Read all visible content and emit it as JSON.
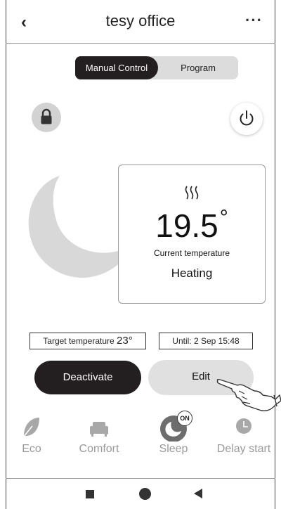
{
  "header": {
    "back_icon": "chevron-left-icon",
    "title": "tesy office",
    "more_icon": "more-horizontal-icon"
  },
  "segment": {
    "active_label": "Manual Control",
    "inactive_label": "Program"
  },
  "controls": {
    "lock_icon": "lock-icon",
    "power_icon": "power-icon"
  },
  "mode_graphic": "moon-icon",
  "temperature_card": {
    "heat_icon": "heating-waves-icon",
    "value": "19.5",
    "unit": "°",
    "caption": "Current temperature",
    "status": "Heating"
  },
  "target": {
    "label": "Target temperature",
    "value": "23",
    "unit": "°"
  },
  "until": {
    "text": "Until: 2 Sep 15:48"
  },
  "actions": {
    "deactivate_label": "Deactivate",
    "edit_label": "Edit"
  },
  "modes": [
    {
      "label": "Eco",
      "icon": "leaf-icon"
    },
    {
      "label": "Comfort",
      "icon": "armchair-icon"
    },
    {
      "label": "Sleep",
      "icon": "moon-icon",
      "badge": "ON"
    },
    {
      "label": "Delay start",
      "icon": "clock-icon"
    }
  ],
  "nav": {
    "recents_icon": "square-icon",
    "home_icon": "circle-icon",
    "back_icon": "triangle-back-icon"
  },
  "colors": {
    "dark": "#231f20",
    "grey": "#d2d2d2",
    "muted_text": "#9a9a9a"
  }
}
